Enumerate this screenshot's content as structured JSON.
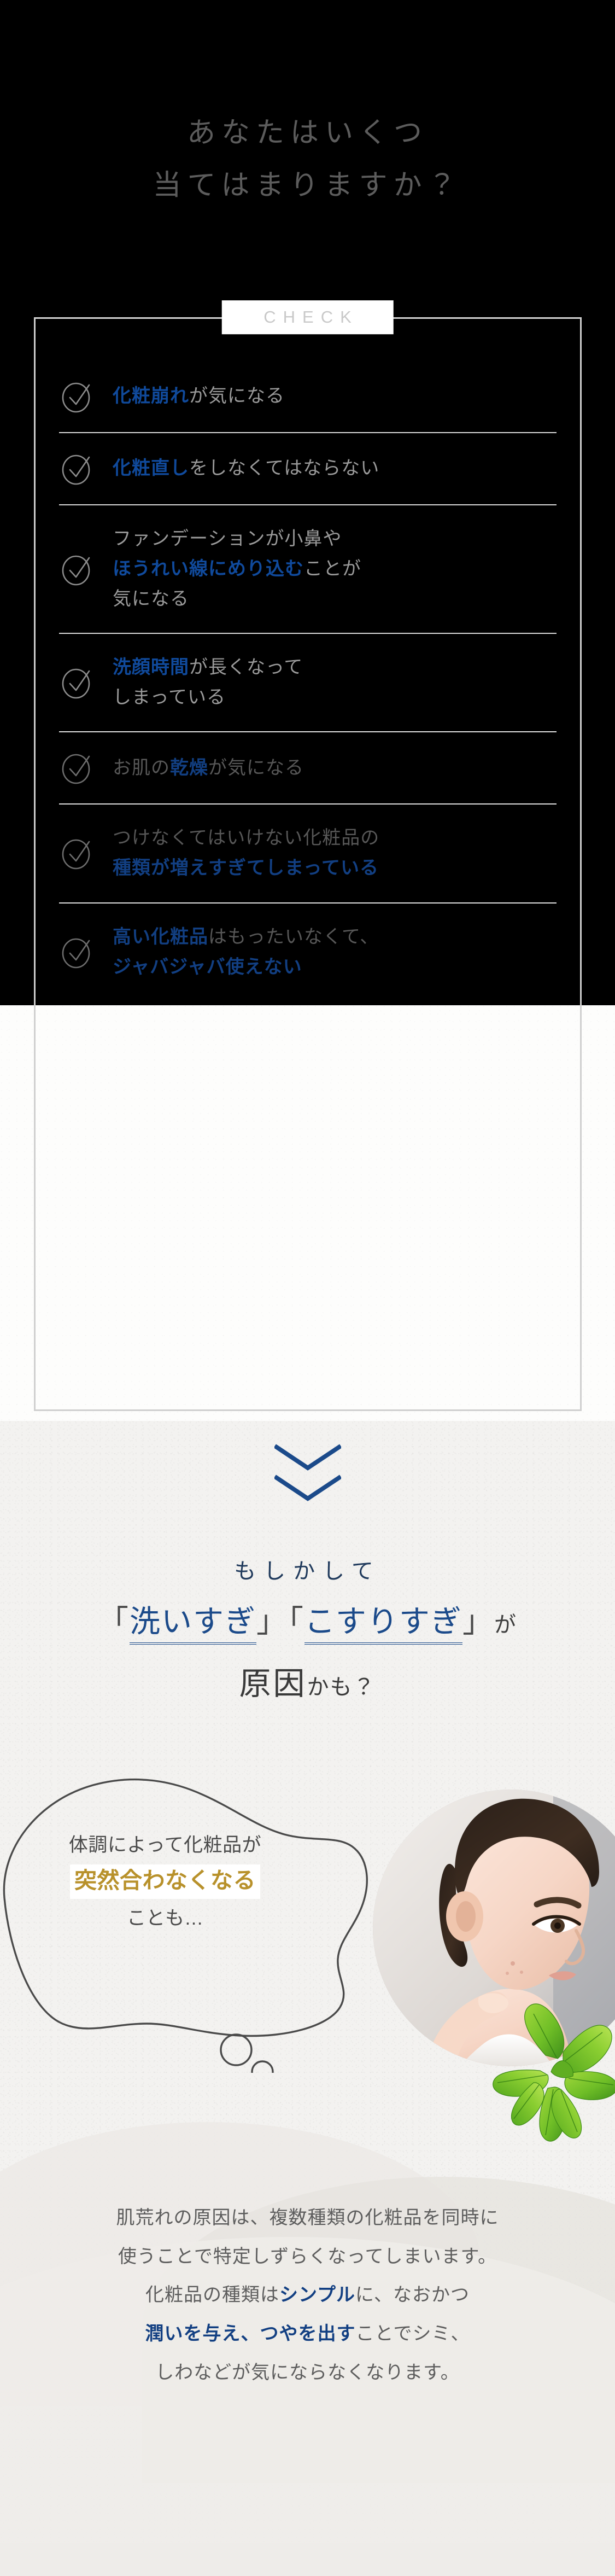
{
  "hero": {
    "line1": "あなたはいくつ",
    "line2": "当てはまりますか？"
  },
  "check_section": {
    "badge_label": "CHECK",
    "items": [
      {
        "id": "item-1",
        "theme": "dark",
        "lines": [
          [
            {
              "t": "化粧崩れ",
              "hl": true
            },
            {
              "t": "が気になる",
              "hl": false
            }
          ]
        ]
      },
      {
        "id": "item-2",
        "theme": "dark",
        "lines": [
          [
            {
              "t": "化粧直し",
              "hl": true
            },
            {
              "t": "をしなくてはならない",
              "hl": false
            }
          ]
        ]
      },
      {
        "id": "item-3",
        "theme": "dark",
        "lines": [
          [
            {
              "t": "ファンデーションが小鼻や",
              "hl": false
            }
          ],
          [
            {
              "t": "ほうれい線にめり込む",
              "hl": true
            },
            {
              "t": "ことが",
              "hl": false
            }
          ],
          [
            {
              "t": "気になる",
              "hl": false
            }
          ]
        ]
      },
      {
        "id": "item-4",
        "theme": "dark",
        "lines": [
          [
            {
              "t": "洗顔時間",
              "hl": true
            },
            {
              "t": "が長くなって",
              "hl": false
            }
          ],
          [
            {
              "t": "しまっている",
              "hl": false
            }
          ]
        ]
      },
      {
        "id": "item-5",
        "theme": "light",
        "lines": [
          [
            {
              "t": "お肌の",
              "hl": false
            },
            {
              "t": "乾燥",
              "hl": true
            },
            {
              "t": "が気になる",
              "hl": false
            }
          ]
        ]
      },
      {
        "id": "item-6",
        "theme": "light",
        "lines": [
          [
            {
              "t": "つけなくてはいけない化粧品の",
              "hl": false
            }
          ],
          [
            {
              "t": "種類が増えすぎてしまっている",
              "hl": true
            }
          ]
        ]
      },
      {
        "id": "item-7",
        "theme": "light",
        "lines": [
          [
            {
              "t": "高い化粧品",
              "hl": true
            },
            {
              "t": "はもったいなくて、",
              "hl": false
            }
          ],
          [
            {
              "t": "ジャバジャバ使えない",
              "hl": true
            }
          ]
        ]
      }
    ]
  },
  "arrow": {
    "icon": "double-chevron-down-icon"
  },
  "cause_block": {
    "lead": "もしかして",
    "bracket_open": "「",
    "bracket_close": "」",
    "keyword_1": "洗いすぎ",
    "keyword_2": "こすりすぎ",
    "particle": "が",
    "main": "原因",
    "suffix": "かも？"
  },
  "bubble": {
    "line1": "体調によって化粧品が",
    "highlight": "突然合わなくなる",
    "line3": "ことも…"
  },
  "photo": {
    "alt": "woman-touching-cheek-photo"
  },
  "leaves": {
    "alt": "green-basil-leaves"
  },
  "final_paragraph": {
    "lines": [
      [
        {
          "t": "肌荒れの原因は、複数種類の化粧品を同時に",
          "hl": false
        }
      ],
      [
        {
          "t": "使うことで特定しずらくなってしまいます。",
          "hl": false
        }
      ],
      [
        {
          "t": "化粧品の種類は",
          "hl": false
        },
        {
          "t": "シンプル",
          "hl": true
        },
        {
          "t": "に、なおかつ",
          "hl": false
        }
      ],
      [
        {
          "t": "潤いを与え、つやを出す",
          "hl": true
        },
        {
          "t": "ことでシミ、",
          "hl": false
        }
      ],
      [
        {
          "t": "しわなどが気にならなくなります。",
          "hl": false
        }
      ]
    ]
  },
  "colors": {
    "accent_blue": "#123f82",
    "accent_blue_dark_bg": "#104a9c",
    "gold": "#b8912b",
    "hero_text": "#5c5c5c",
    "dark_bg": "#000000",
    "paper_bg": "#f3f2f0",
    "navy_serif": "#203a5c"
  }
}
